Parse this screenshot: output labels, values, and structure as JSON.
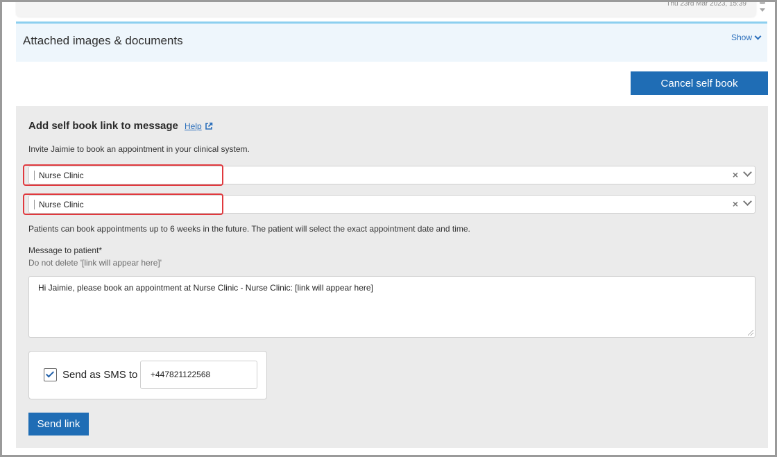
{
  "top_card": {
    "timestamp": "Thu 23rd Mar 2023, 15:39"
  },
  "attachments": {
    "title": "Attached images & documents",
    "toggle_label": "Show"
  },
  "cancel_button": "Cancel self book",
  "self_book": {
    "heading": "Add self book link to message",
    "help_label": "Help",
    "invite_text": "Invite Jaimie to book an appointment in your clinical system.",
    "select_1": {
      "value": "Nurse Clinic",
      "clear": "×"
    },
    "select_2": {
      "value": "Nurse Clinic",
      "clear": "×"
    },
    "info_text": "Patients can book appointments up to 6 weeks in the future. The patient will select the exact appointment date and time.",
    "message_label": "Message to patient*",
    "message_hint": "Do not delete '[link will appear here]'",
    "message_value": "Hi Jaimie, please book an appointment at Nurse Clinic - Nurse Clinic: [link will appear here]",
    "sms": {
      "checked": true,
      "label": "Send as SMS to",
      "phone": "+447821122568"
    },
    "send_button": "Send link"
  },
  "colors": {
    "accent": "#1f6db5",
    "highlight": "#e0393e",
    "link": "#2a6ebb"
  }
}
